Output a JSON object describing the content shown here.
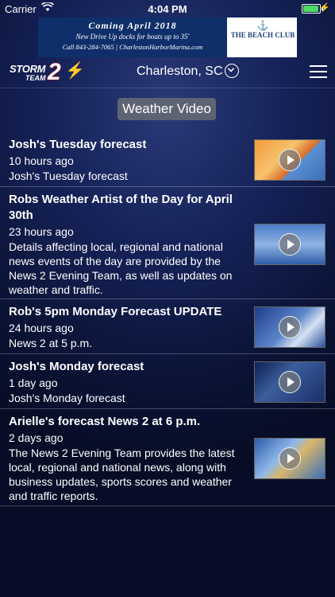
{
  "status": {
    "carrier": "Carrier",
    "time": "4:04 PM"
  },
  "ad": {
    "line1": "Coming April 2018",
    "line2": "New Drive Up docks for boats up to 35'",
    "line3": "Call 843-284-7065 | CharlestonHarborMarina.com",
    "club": "THE BEACH CLUB"
  },
  "nav": {
    "logo_text": "STORM",
    "logo_team": "TEAM",
    "logo_number": "2",
    "city": "Charleston, SC"
  },
  "section_title": "Weather Video",
  "videos": [
    {
      "title": "Josh's Tuesday forecast",
      "time": "10 hours ago",
      "description": "Josh's Tuesday forecast"
    },
    {
      "title": "Robs Weather Artist of the Day for April 30th",
      "time": "23 hours ago",
      "description": "Details affecting local, regional and national news events of the day are provided by the News 2 Evening Team, as well as updates on weather and traffic."
    },
    {
      "title": "Rob's 5pm Monday Forecast UPDATE",
      "time": "24 hours ago",
      "description": "News 2 at 5 p.m."
    },
    {
      "title": "Josh's Monday forecast",
      "time": "1 day ago",
      "description": "Josh's Monday forecast"
    },
    {
      "title": "Arielle's forecast News 2 at 6 p.m.",
      "time": "2 days ago",
      "description": "The News 2 Evening Team provides the latest local, regional and national news, along with business updates, sports scores and weather and traffic reports."
    }
  ]
}
